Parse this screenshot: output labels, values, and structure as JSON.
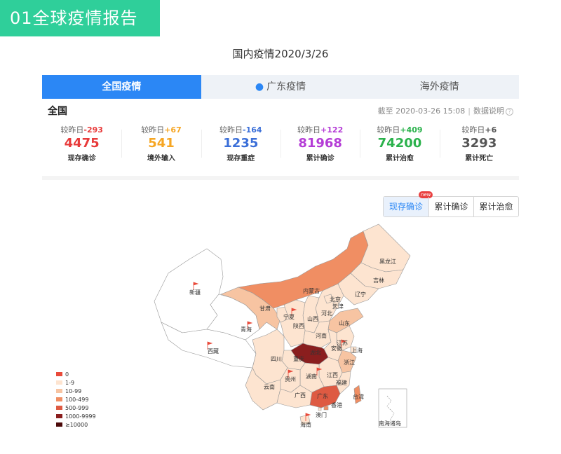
{
  "section_badge": "01全球疫情报告",
  "page_title": "国内疫情2020/3/26",
  "tabs": [
    {
      "label": "全国疫情"
    },
    {
      "label": "广东疫情"
    },
    {
      "label": "海外疫情"
    }
  ],
  "summary": {
    "title": "全国",
    "timestamp": "截至 2020-03-26 15:08",
    "data_note": "数据说明",
    "help_glyph": "?",
    "delta_prefix": "较昨日",
    "stats": [
      {
        "delta": "-293",
        "value": "4475",
        "label": "现存确诊",
        "color": "#e83a3a"
      },
      {
        "delta": "+67",
        "value": "541",
        "label": "境外输入",
        "color": "#f6a623"
      },
      {
        "delta": "-164",
        "value": "1235",
        "label": "现存重症",
        "color": "#3b6fd8"
      },
      {
        "delta": "+122",
        "value": "81968",
        "label": "累计确诊",
        "color": "#b43cd6"
      },
      {
        "delta": "+409",
        "value": "74200",
        "label": "累计治愈",
        "color": "#2bb24c"
      },
      {
        "delta": "+6",
        "value": "3293",
        "label": "累计死亡",
        "color": "#555555"
      }
    ]
  },
  "map_toggle": {
    "new_badge": "new",
    "options": [
      {
        "label": "现存确诊"
      },
      {
        "label": "累计确诊"
      },
      {
        "label": "累计治愈"
      }
    ]
  },
  "map": {
    "provinces": [
      "黑龙江",
      "吉林",
      "辽宁",
      "内蒙古",
      "北京",
      "天津",
      "河北",
      "新疆",
      "甘肃",
      "宁夏",
      "山西",
      "山东",
      "青海",
      "陕西",
      "河南",
      "江苏",
      "安徽",
      "上海",
      "西藏",
      "四川",
      "重庆",
      "湖北",
      "浙江",
      "贵州",
      "湖南",
      "江西",
      "福建",
      "云南",
      "广西",
      "广东",
      "台湾",
      "香港",
      "澳门",
      "海南",
      "南海诸岛"
    ],
    "colors": {
      "c0": "#ffffff",
      "c1": "#fde4d0",
      "c2": "#f7c4a2",
      "c3": "#f08e63",
      "c4": "#de5a42",
      "c5": "#c63b2e",
      "c6": "#8a1e1e",
      "c7": "#4c0a0a"
    }
  },
  "legend": [
    {
      "label": "0",
      "color": "#e94a3a"
    },
    {
      "label": "1-9",
      "color": "#fde4d0"
    },
    {
      "label": "10-99",
      "color": "#f7c4a2"
    },
    {
      "label": "100-499",
      "color": "#f08e63"
    },
    {
      "label": "500-999",
      "color": "#de5a42"
    },
    {
      "label": "1000-9999",
      "color": "#8a1e1e"
    },
    {
      "label": "≥10000",
      "color": "#4c0a0a"
    }
  ]
}
